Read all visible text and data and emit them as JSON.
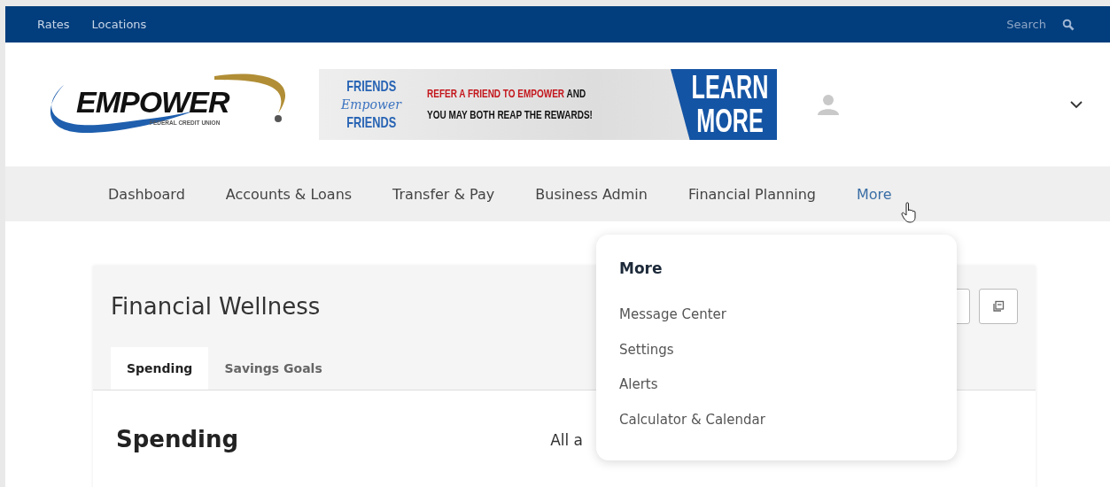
{
  "top_bar": {
    "links": [
      "Rates",
      "Locations"
    ],
    "search_label": "Search"
  },
  "logo": {
    "name": "EMPOWER",
    "subtitle": "FEDERAL CREDIT UNION"
  },
  "banner": {
    "left_top": "FRIENDS",
    "left_middle": "Empower",
    "left_bottom": "FRIENDS",
    "line_1_red": "REFER A FRIEND TO EMPOWER",
    "line_1_rest": "AND",
    "line_2": "YOU MAY BOTH REAP THE REWARDS!",
    "cta_1": "LEARN",
    "cta_2": "MORE"
  },
  "nav": [
    {
      "label": "Dashboard",
      "selected": false
    },
    {
      "label": "Accounts & Loans",
      "selected": false
    },
    {
      "label": "Transfer & Pay",
      "selected": false
    },
    {
      "label": "Business Admin",
      "selected": false
    },
    {
      "label": "Financial Planning",
      "selected": false
    },
    {
      "label": "More",
      "selected": true
    }
  ],
  "card": {
    "title": "Financial Wellness",
    "tabs": [
      {
        "label": "Spending",
        "selected": true
      },
      {
        "label": "Savings Goals",
        "selected": false
      }
    ],
    "section_title": "Spending",
    "filter_text": "All a"
  },
  "dropdown": {
    "title": "More",
    "items": [
      "Message Center",
      "Settings",
      "Alerts",
      "Calculator & Calendar"
    ]
  }
}
